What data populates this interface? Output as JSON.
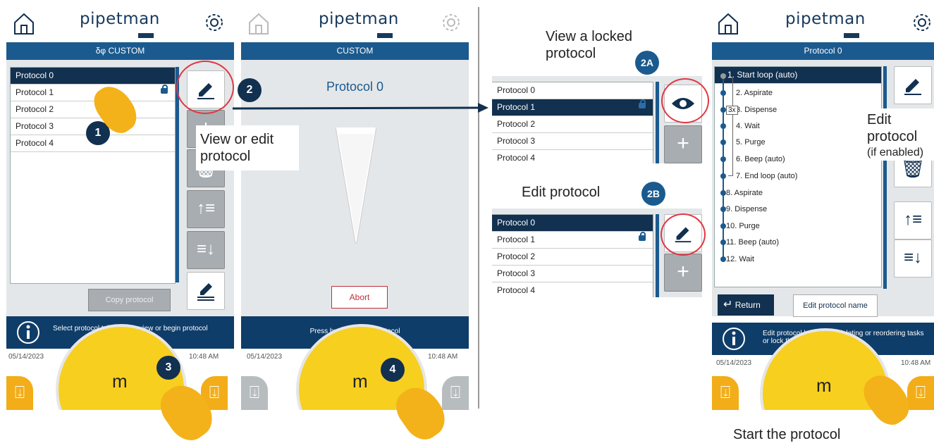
{
  "brand": "pipetman",
  "screen1": {
    "header": "CUSTOM",
    "protocols": [
      "Protocol 0",
      "Protocol 1",
      "Protocol 2",
      "Protocol 3",
      "Protocol 4"
    ],
    "copy_button": "Copy protocol",
    "info": "Select protocol table cell to view or begin protocol",
    "date": "05/14/2023",
    "time": "10:48 AM",
    "knob": "m"
  },
  "screen2": {
    "header": "CUSTOM",
    "title": "Protocol 0",
    "abort": "Abort",
    "info": "Press button to start protocol",
    "date": "05/14/2023",
    "time": "10:48 AM",
    "knob": "m"
  },
  "middle": {
    "locked_caption": "View a locked protocol",
    "edit_caption": "Edit protocol",
    "badge_2a": "2A",
    "badge_2b": "2B",
    "protocols": [
      "Protocol 0",
      "Protocol 1",
      "Protocol 2",
      "Protocol 3",
      "Protocol 4"
    ]
  },
  "screen3": {
    "header": "Protocol 0",
    "steps": [
      "1. Start loop (auto)",
      "2. Aspirate",
      "3. Dispense",
      "4. Wait",
      "5. Purge",
      "6. Beep (auto)",
      "7. End loop (auto)",
      "8. Aspirate",
      "9. Dispense",
      "10. Purge",
      "11. Beep (auto)",
      "12. Wait"
    ],
    "loop_count": "3x",
    "return": "Return",
    "edit_name": "Edit protocol name",
    "info": "Edit protocol by adding, deleting or reordering tasks or lock the protocol.",
    "date": "05/14/2023",
    "time": "10:48 AM",
    "knob": "m"
  },
  "callouts": {
    "badge1": "1",
    "badge2": "2",
    "badge3": "3",
    "badge4": "4",
    "view_edit": "View or edit protocol",
    "edit_protocol": "Edit protocol",
    "if_enabled": "(if enabled)",
    "start": "Start the protocol"
  },
  "colors": {
    "navy": "#12304f",
    "blue": "#1b5a8e",
    "yellow": "#f7cf1f",
    "orange": "#f2ad18",
    "red": "#e03844"
  }
}
